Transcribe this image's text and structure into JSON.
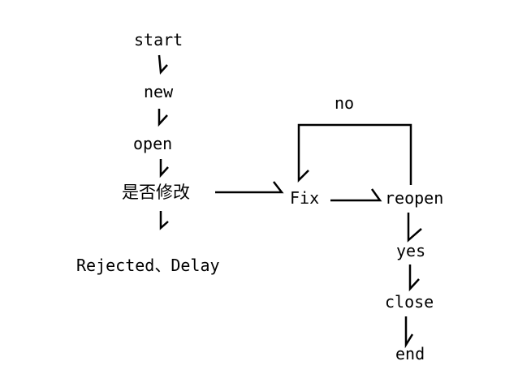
{
  "diagram": {
    "nodes": {
      "start": "start",
      "new": "new",
      "open": "open",
      "decision": "是否修改",
      "rejected": "Rejected、Delay",
      "fix": "Fix",
      "reopen": "reopen",
      "yes": "yes",
      "close": "close",
      "end": "end"
    },
    "edge_labels": {
      "no": "no"
    },
    "colors": {
      "line": "#000000",
      "text": "#000000",
      "background": "#ffffff"
    }
  }
}
